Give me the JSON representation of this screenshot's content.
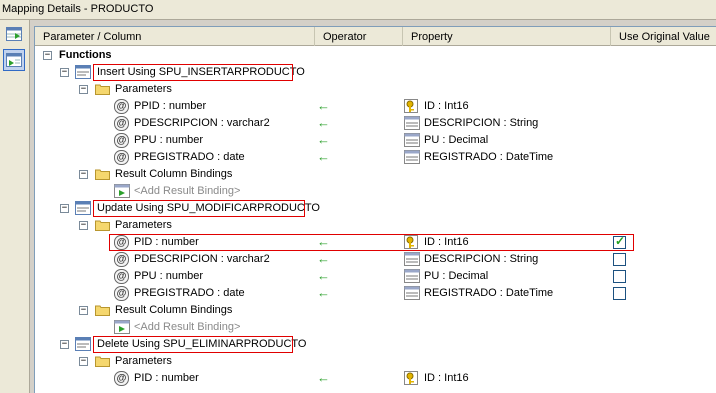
{
  "window": {
    "title": "Mapping Details - PRODUCTO"
  },
  "sidebar": {
    "buttons": [
      {
        "icon": "table-mapping-icon"
      },
      {
        "icon": "function-mapping-icon"
      }
    ]
  },
  "columns": {
    "parameter": "Parameter / Column",
    "operator": "Operator",
    "property": "Property",
    "use_original": "Use Original Value"
  },
  "tree": {
    "root_label": "Functions",
    "functions": [
      {
        "label": "Insert Using SPU_INSERTARPRODUCTO",
        "parameters_label": "Parameters",
        "parameters": [
          {
            "name": "PPID : number",
            "operator": "←",
            "property": "ID : Int16",
            "key": true
          },
          {
            "name": "PDESCRIPCION : varchar2",
            "operator": "←",
            "property": "DESCRIPCION : String",
            "key": false
          },
          {
            "name": "PPU : number",
            "operator": "←",
            "property": "PU : Decimal",
            "key": false
          },
          {
            "name": "PREGISTRADO : date",
            "operator": "←",
            "property": "REGISTRADO : DateTime",
            "key": false
          }
        ],
        "result_label": "Result Column Bindings",
        "add_binding": "<Add Result Binding>"
      },
      {
        "label": "Update Using SPU_MODIFICARPRODUCTO",
        "parameters_label": "Parameters",
        "parameters": [
          {
            "name": "PID : number",
            "operator": "←",
            "property": "ID : Int16",
            "key": true,
            "use_original": true
          },
          {
            "name": "PDESCRIPCION : varchar2",
            "operator": "←",
            "property": "DESCRIPCION : String",
            "key": false,
            "use_original": false
          },
          {
            "name": "PPU : number",
            "operator": "←",
            "property": "PU : Decimal",
            "key": false,
            "use_original": false
          },
          {
            "name": "PREGISTRADO : date",
            "operator": "←",
            "property": "REGISTRADO : DateTime",
            "key": false,
            "use_original": false
          }
        ],
        "result_label": "Result Column Bindings",
        "add_binding": "<Add Result Binding>"
      },
      {
        "label": "Delete Using SPU_ELIMINARPRODUCTO",
        "parameters_label": "Parameters",
        "parameters": [
          {
            "name": "PID : number",
            "operator": "←",
            "property": "ID : Int16",
            "key": true
          }
        ]
      }
    ]
  },
  "colors": {
    "highlight_border": "#e00000",
    "arrow": "#2ca02c",
    "checkmark": "#21a121"
  }
}
